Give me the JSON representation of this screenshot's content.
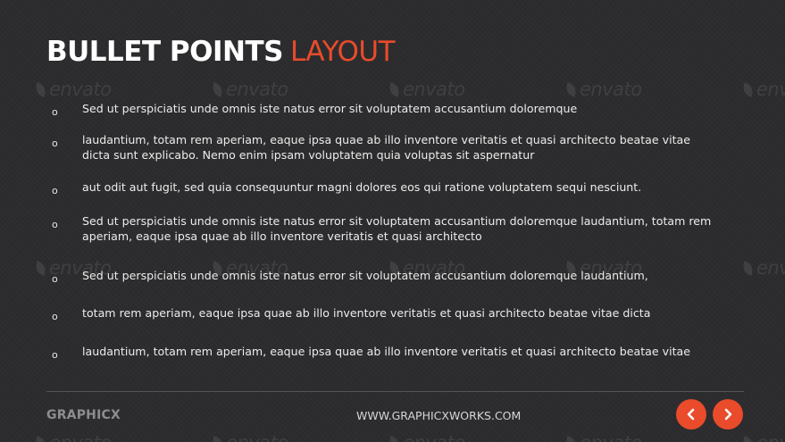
{
  "title": {
    "bold": "BULLET POINTS",
    "accent": "LAYOUT"
  },
  "watermark": {
    "text": "envato"
  },
  "bullets": [
    {
      "marker": "o",
      "text": "Sed ut perspiciatis unde omnis iste natus error sit voluptatem accusantium doloremque"
    },
    {
      "marker": "o",
      "text": "laudantium, totam rem aperiam, eaque ipsa quae ab illo  inventore veritatis et quasi architecto beatae vitae dicta sunt explicabo. Nemo enim ipsam voluptatem quia voluptas sit aspernatur"
    },
    {
      "marker": "o",
      "text": "aut odit aut fugit, sed quia consequuntur magni dolores eos qui ratione voluptatem sequi nesciunt."
    },
    {
      "marker": "o",
      "text": "Sed ut perspiciatis unde omnis iste natus error sit voluptatem accusantium doloremque laudantium, totam rem aperiam, eaque ipsa quae ab illo inventore veritatis et quasi architecto"
    },
    {
      "marker": "o",
      "text": "Sed ut perspiciatis unde omnis iste natus error sit voluptatem accusantium doloremque laudantium,"
    },
    {
      "marker": "o",
      "text": "totam rem aperiam, eaque ipsa quae ab illo inventore veritatis et quasi architecto beatae vitae dicta"
    },
    {
      "marker": "o",
      "text": "laudantium, totam rem aperiam, eaque ipsa quae ab illo  inventore veritatis et quasi architecto beatae vitae"
    }
  ],
  "footer": {
    "brand": "GRAPHICX",
    "website": "WWW.GRAPHICXWORKS.COM",
    "prev_icon": "chevron-left-icon",
    "next_icon": "chevron-right-icon"
  },
  "colors": {
    "background": "#2c2c2e",
    "accent": "#e94b2b",
    "text": "#ececec",
    "muted": "#8d8d8f"
  }
}
